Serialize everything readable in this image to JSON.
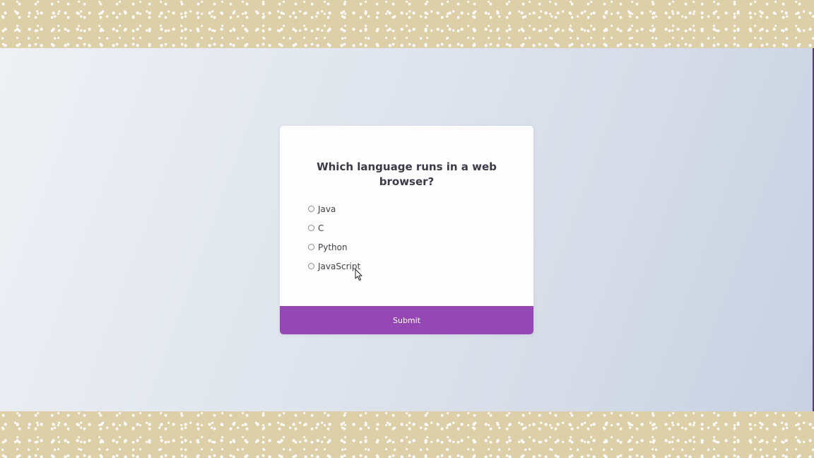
{
  "quiz": {
    "question": "Which language runs in a web browser?",
    "options": [
      {
        "label": "Java",
        "selected": false
      },
      {
        "label": "C",
        "selected": false
      },
      {
        "label": "Python",
        "selected": false
      },
      {
        "label": "JavaScript",
        "selected": false
      }
    ],
    "submit_label": "Submit"
  },
  "colors": {
    "accent": "#9547b3",
    "frame_border": "#ddcfa8",
    "card_background": "#fdfdfd",
    "question_text": "#3b3b48"
  },
  "icons": {
    "cursor": "mouse-pointer-icon"
  }
}
